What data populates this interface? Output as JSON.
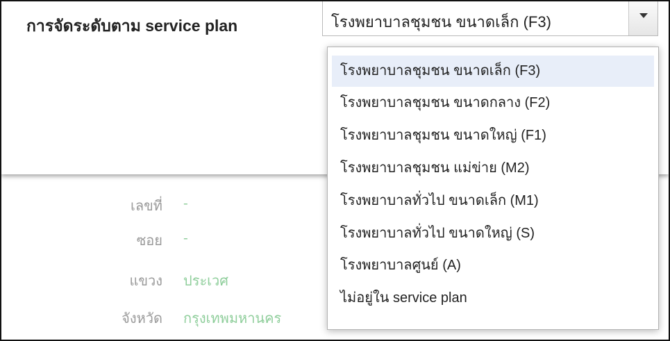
{
  "service_plan": {
    "label": "การจัดระดับตาม service plan",
    "selected_value": "โรงพยาบาลชุมชน ขนาดเล็ก (F3)",
    "options": [
      "โรงพยาบาลชุมชน ขนาดเล็ก (F3)",
      "โรงพยาบาลชุมชน ขนาดกลาง (F2)",
      "โรงพยาบาลชุมชน ขนาดใหญ่ (F1)",
      "โรงพยาบาลชุมชน แม่ข่าย (M2)",
      "โรงพยาบาลทั่วไป ขนาดเล็ก (M1)",
      "โรงพยาบาลทั่วไป ขนาดใหญ่ (S)",
      "โรงพยาบาลศูนย์ (A)",
      "ไม่อยู่ใน service plan"
    ],
    "highlighted_index": 0
  },
  "address": {
    "fields": [
      {
        "label": "เลขที่",
        "value": "-"
      },
      {
        "label": "ซอย",
        "value": "-"
      },
      {
        "label": "แขวง",
        "value": "ประเวศ"
      },
      {
        "label": "จังหวัด",
        "value": "กรุงเทพมหานคร"
      }
    ]
  },
  "colors": {
    "highlight": "#e8eef9",
    "value_green": "#8fce9b",
    "label_gray": "#9a9a9a"
  },
  "icons": {
    "dropdown_arrow": "caret-down-icon"
  }
}
